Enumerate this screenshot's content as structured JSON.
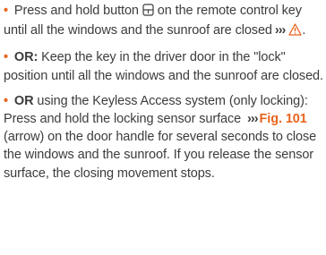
{
  "colors": {
    "accent": "#e8641e",
    "text": "#3c3c3c"
  },
  "icons": {
    "bullet": "bullet-dot",
    "lock_button": "lock-button-icon",
    "warning": "warning-triangle-icon",
    "arrows": "reference-arrows"
  },
  "item1": {
    "text_before_icon": "Press and hold button",
    "text_after_icon": "on the remote control key until all the windows and the sunroof are closed",
    "arrows": "›››",
    "tail": "."
  },
  "item2": {
    "lead": "OR:",
    "text": "Keep the key in the driver door in the \"lock\" position until all the windows and the sunroof are closed."
  },
  "item3": {
    "lead": "OR",
    "text_before_ref": "using the Keyless Access system (only locking): Press and hold the locking sensor surface",
    "arrows": "›››",
    "figure_ref": "Fig. 101",
    "text_after_ref": "(arrow) on the door handle for several seconds to close the windows and the sunroof. If you release the sensor surface, the closing movement stops."
  }
}
